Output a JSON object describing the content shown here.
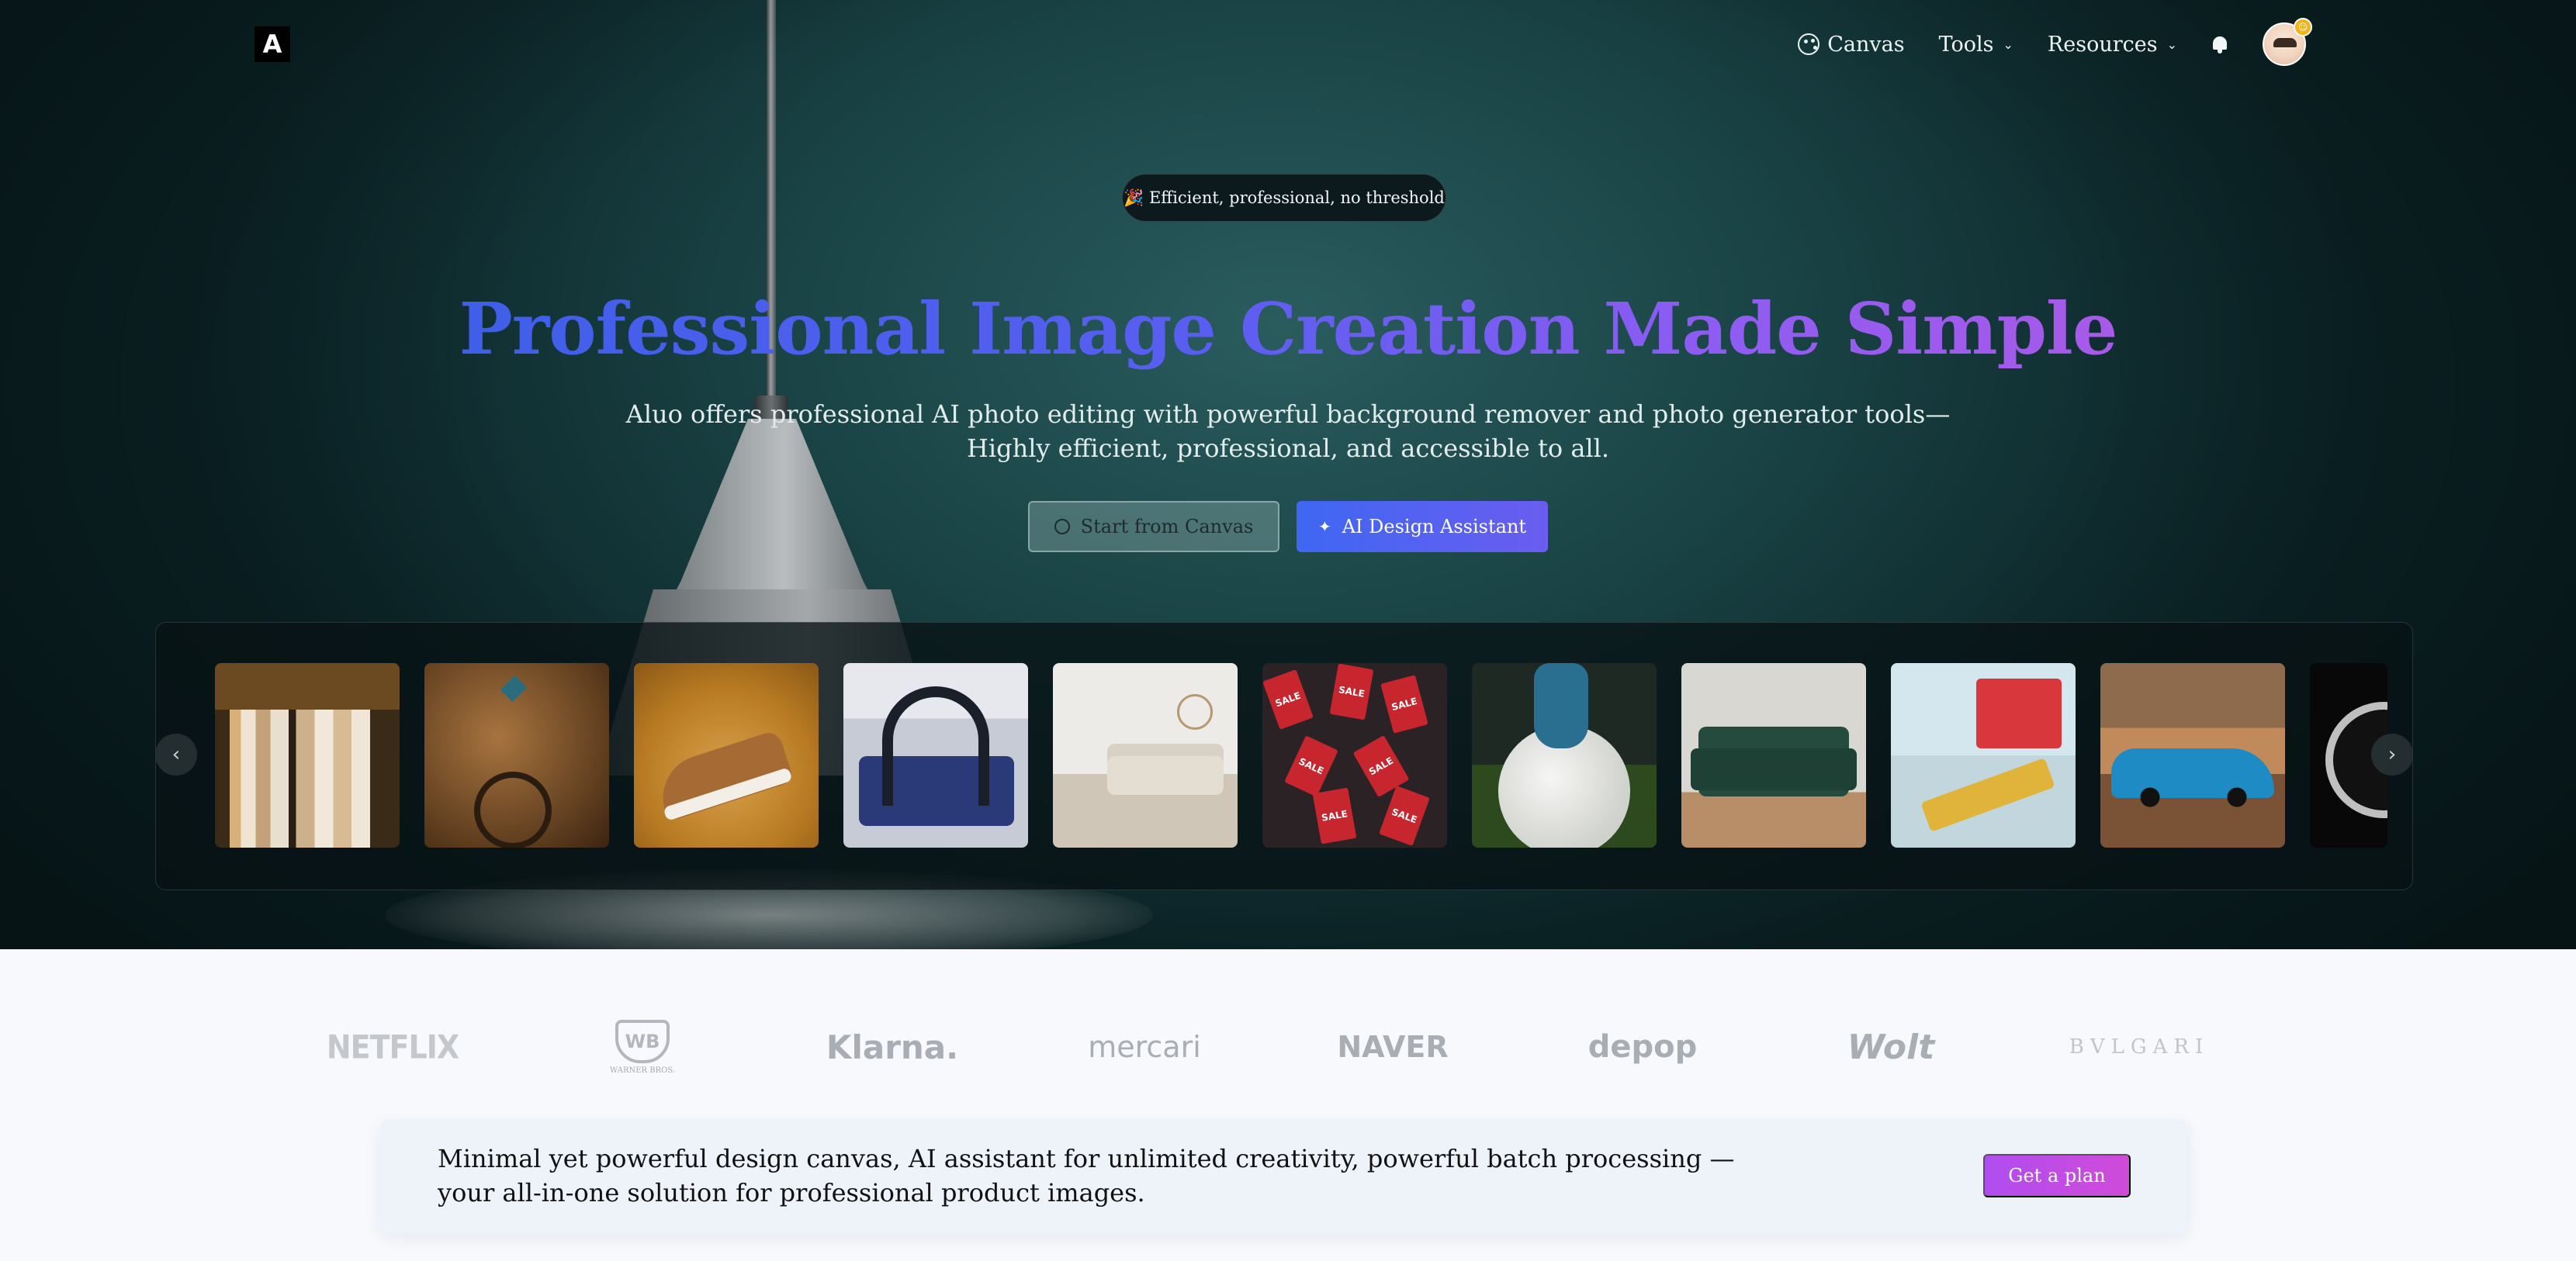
{
  "nav": {
    "logo": "A",
    "items": [
      {
        "label": "Canvas",
        "icon": "palette-icon"
      },
      {
        "label": "Tools",
        "icon": "chevron-down-icon"
      },
      {
        "label": "Resources",
        "icon": "chevron-down-icon"
      }
    ],
    "notifications_icon": "bell-icon",
    "avatar_badge": "☺"
  },
  "hero": {
    "pill": "🎉 Efficient, professional, no threshold",
    "headline": "Professional Image Creation Made Simple",
    "subtitle_line1": "Aluo offers professional AI photo editing with powerful background remover and photo generator tools—",
    "subtitle_line2": "Highly efficient, professional, and accessible to all.",
    "cta_canvas": "Start from Canvas",
    "cta_ai": "AI Design Assistant"
  },
  "carousel": {
    "prev_icon": "‹",
    "next_icon": "›",
    "items": [
      "clothing-rack",
      "necklace",
      "sneaker",
      "headphones",
      "living-room",
      "sale-tags",
      "soccer-ball",
      "green-sofa",
      "toy-train",
      "blue-car",
      "watch"
    ],
    "sale_tag": "SALE"
  },
  "brands": {
    "netflix": "NETFLIX",
    "wb_shield": "WB",
    "wb_text": "WARNER BROS.",
    "klarna": "Klarna.",
    "mercari": "mercari",
    "naver": "NAVER",
    "depop": "depop",
    "wolt": "Wolt",
    "bvlgari": "BVLGARI"
  },
  "promo": {
    "text": "Minimal yet powerful design canvas, AI assistant for unlimited creativity, powerful batch processing — your all-in-one solution for professional product images.",
    "button": "Get a plan"
  },
  "colors": {
    "headline_start": "#3f5fe8",
    "headline_end": "#a85ae8",
    "ai_button": "#4f63f2",
    "promo_button": "#c04ce6"
  }
}
